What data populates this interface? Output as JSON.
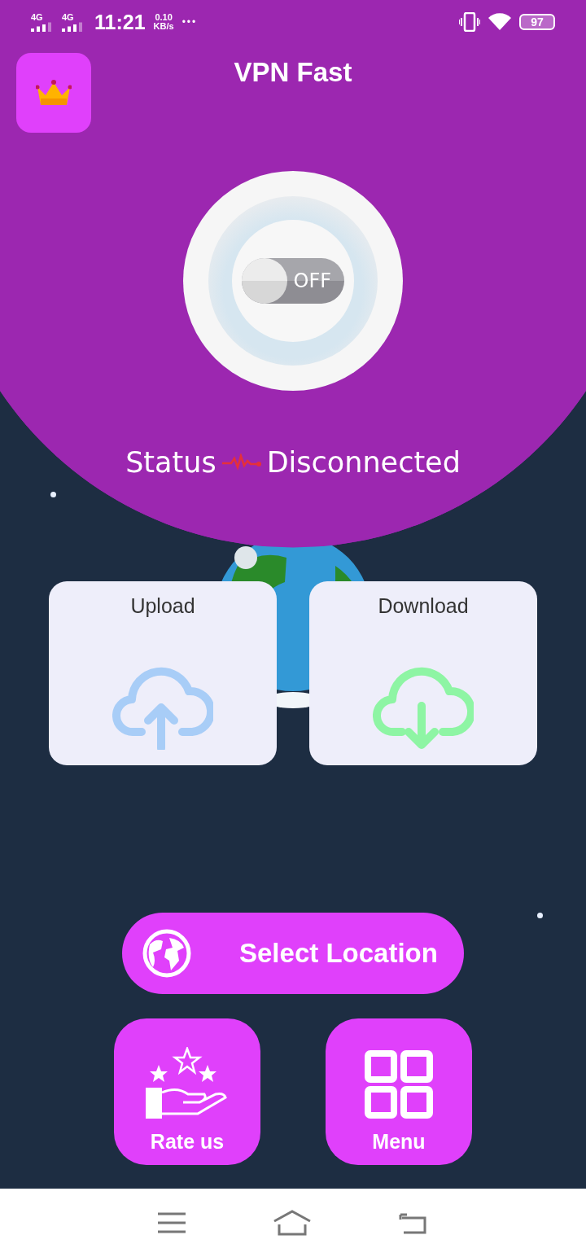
{
  "status_bar": {
    "networks": [
      "4G",
      "4G"
    ],
    "time": "11:21",
    "speed": "0.10",
    "speed_unit": "KB/s",
    "more": "•••",
    "battery": "97"
  },
  "header": {
    "title": "VPN Fast"
  },
  "vpn_toggle": {
    "label": "OFF",
    "on": false
  },
  "status": {
    "label": "Status",
    "value": "Disconnected"
  },
  "stats": [
    {
      "kind": "upload",
      "label": "Upload"
    },
    {
      "kind": "download",
      "label": "Download"
    }
  ],
  "select_location": {
    "label": "Select Location"
  },
  "actions": [
    {
      "kind": "rate",
      "label": "Rate us"
    },
    {
      "kind": "menu",
      "label": "Menu"
    }
  ]
}
